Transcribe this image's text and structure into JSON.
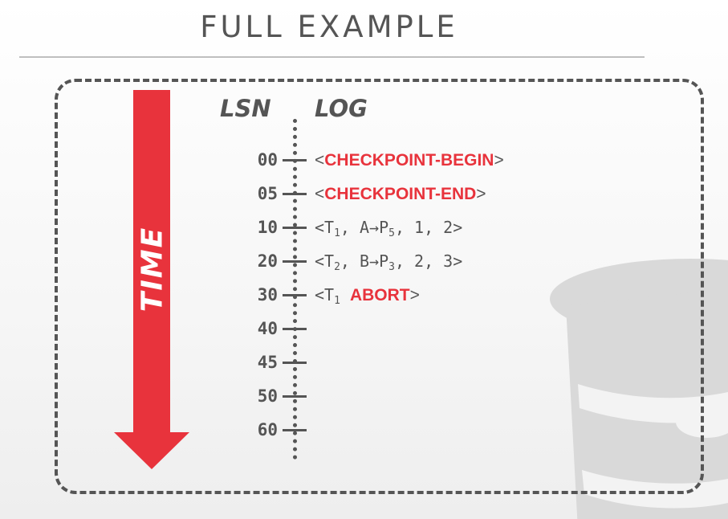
{
  "slide": {
    "title": "FULL EXAMPLE",
    "time_label": "TIME",
    "lsn_header": "LSN",
    "log_header": "LOG"
  },
  "colors": {
    "accent": "#e8333c",
    "text": "#555555",
    "rule": "#bfbfbf"
  },
  "entries": [
    {
      "lsn": "00",
      "open": "<",
      "keyword": "CHECKPOINT-BEGIN",
      "close": ">"
    },
    {
      "lsn": "05",
      "open": "<",
      "keyword": "CHECKPOINT-END",
      "close": ">"
    },
    {
      "lsn": "10",
      "open": "<T",
      "txn": "1",
      "mid": ", A→P",
      "page": "5",
      "rest": ", 1, 2>"
    },
    {
      "lsn": "20",
      "open": "<T",
      "txn": "2",
      "mid": ", B→P",
      "page": "3",
      "rest": ", 2, 3>"
    },
    {
      "lsn": "30",
      "open": "<T",
      "txn": "1",
      "keyword": "ABORT",
      "close": ">"
    },
    {
      "lsn": "40"
    },
    {
      "lsn": "45"
    },
    {
      "lsn": "50"
    },
    {
      "lsn": "60"
    }
  ]
}
